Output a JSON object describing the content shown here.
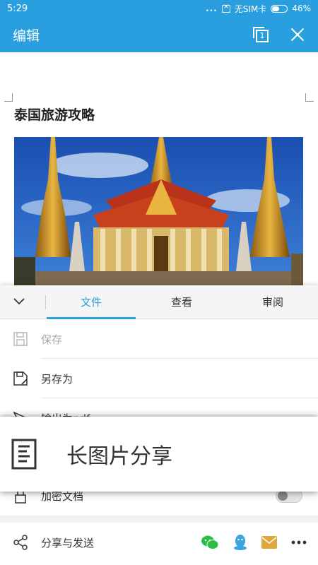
{
  "status": {
    "time": "5:29",
    "dots": "...",
    "sim": "无SIM卡",
    "battery": "46%",
    "battery_level": 0.46
  },
  "appbar": {
    "title": "编辑",
    "page_count": "1"
  },
  "document": {
    "title": "泰国旅游攻略"
  },
  "tabs": [
    {
      "label": "文件",
      "active": true
    },
    {
      "label": "查看",
      "active": false
    },
    {
      "label": "审阅",
      "active": false
    }
  ],
  "menu": {
    "save": "保存",
    "save_as": "另存为",
    "export_pdf": "输出为pdf",
    "encrypt": "加密文档",
    "share_send": "分享与发送"
  },
  "popup": {
    "label": "长图片分享"
  },
  "colors": {
    "accent": "#2a9fe0",
    "wechat": "#2bbf45",
    "qq": "#3aa5e0",
    "mail": "#e0a83a"
  }
}
